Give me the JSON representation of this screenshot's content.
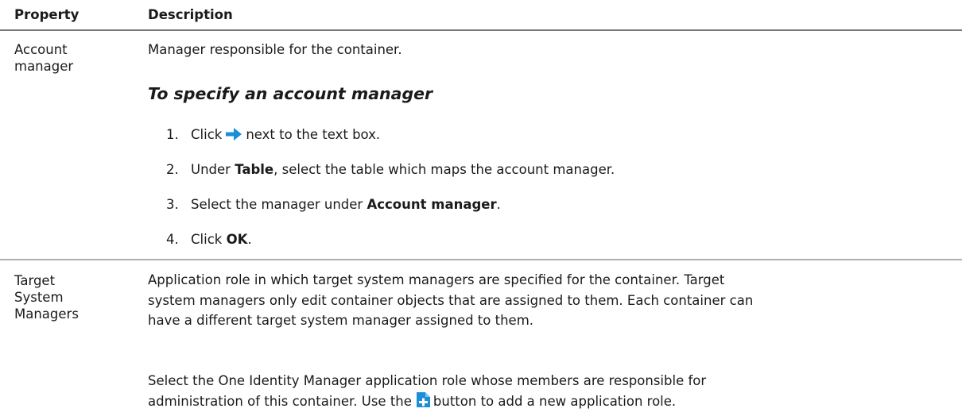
{
  "table": {
    "headers": {
      "property": "Property",
      "description": "Description"
    },
    "rows": [
      {
        "property_lines": [
          "Account",
          "manager"
        ],
        "description": "Manager responsible for the container.",
        "procedure": {
          "heading": "To specify an account manager",
          "steps": [
            {
              "number": "1.",
              "before": "Click",
              "icon": "right-arrow-icon",
              "after": "next to the text box."
            },
            {
              "number": "2.",
              "before": "Under",
              "bold": "Table",
              "after": ", select the table which maps the account manager."
            },
            {
              "number": "3.",
              "before": "Select the manager under",
              "bold": "Account manager",
              "after": "."
            },
            {
              "number": "4.",
              "before": "Click",
              "bold": "OK",
              "after": "."
            }
          ]
        }
      },
      {
        "property_lines": [
          "Target",
          "System",
          "Managers"
        ],
        "description_lines": [
          "Application role in which target system managers are specified for the container. Target",
          "system managers only edit container objects that are assigned to them. Each container can",
          "have a different target system manager assigned to them."
        ],
        "description2_line1": "Select the One Identity Manager application role whose members are responsible for",
        "description2_line2_before": "administration of this container. Use the",
        "description2_icon": "add-document-icon",
        "description2_line2_after": "button to add a new application role."
      }
    ]
  },
  "colors": {
    "arrow": "#1a8fd8",
    "plus_icon": "#1a8fd8",
    "header_rule": "#7a7a7a",
    "row_rule": "#b0b0b0"
  }
}
